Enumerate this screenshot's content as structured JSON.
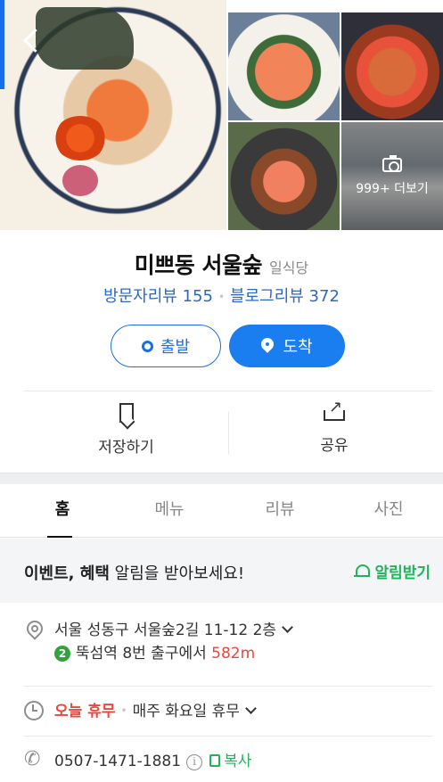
{
  "header": {
    "more_photos_label": "999+ 더보기"
  },
  "place": {
    "name": "미쁘동 서울숲",
    "category": "일식당",
    "visitor_review_label": "방문자리뷰 155",
    "blog_review_label": "블로그리뷰 372"
  },
  "route": {
    "depart_label": "출발",
    "arrive_label": "도착"
  },
  "actions": {
    "save_label": "저장하기",
    "share_label": "공유"
  },
  "tabs": [
    {
      "label": "홈",
      "active": true
    },
    {
      "label": "메뉴",
      "active": false
    },
    {
      "label": "리뷰",
      "active": false
    },
    {
      "label": "사진",
      "active": false
    }
  ],
  "event": {
    "bold_text": "이벤트, 혜택",
    "rest_text": " 알림을 받아보세요!",
    "button_label": "알림받기"
  },
  "info": {
    "address": "서울 성동구 서울숲2길 11-12 2층",
    "subway_line": "2",
    "subway_text": "뚝섬역 8번 출구에서 ",
    "subway_distance": "582m",
    "hours_status": "오늘 휴무",
    "hours_detail": "매주 화요일 휴무",
    "phone": "0507-1471-1881",
    "copy_label": "복사"
  },
  "colors": {
    "brand_blue": "#1a7ef0",
    "link_blue": "#2c67c4",
    "naver_green": "#1fb45a",
    "alert_red": "#e8483c",
    "line2_green": "#33a23d"
  }
}
